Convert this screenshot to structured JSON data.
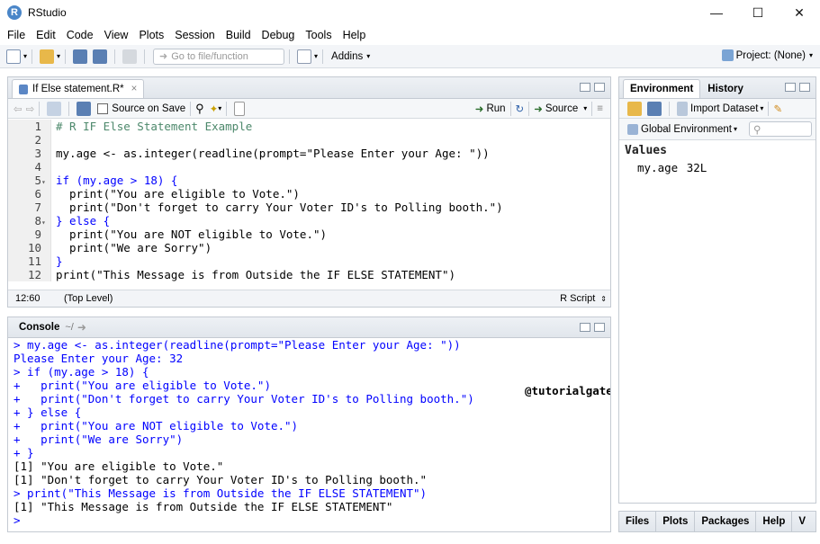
{
  "window": {
    "title": "RStudio",
    "logo": "R"
  },
  "menu": [
    "File",
    "Edit",
    "Code",
    "View",
    "Plots",
    "Session",
    "Build",
    "Debug",
    "Tools",
    "Help"
  ],
  "toolbar": {
    "goto_placeholder": "Go to file/function",
    "addins": "Addins",
    "project": "Project: (None)"
  },
  "editor": {
    "tab": "If Else statement.R*",
    "source_on_save": "Source on Save",
    "run": "Run",
    "source": "Source",
    "lines": [
      "# R IF Else Statement Example",
      "",
      "my.age <- as.integer(readline(prompt=\"Please Enter your Age: \"))",
      "",
      "if (my.age > 18) {",
      "  print(\"You are eligible to Vote.\")",
      "  print(\"Don't forget to carry Your Voter ID's to Polling booth.\")",
      "} else {",
      "  print(\"You are NOT eligible to Vote.\")",
      "  print(\"We are Sorry\")",
      "}",
      "print(\"This Message is from Outside the IF ELSE STATEMENT\")",
      ""
    ],
    "cursor": "12:60",
    "scope": "(Top Level)",
    "filetype": "R Script"
  },
  "console": {
    "title": "Console",
    "path": "~/",
    "watermark": "@tutorialgateway.org",
    "lines": [
      {
        "t": "in",
        "s": "> my.age <- as.integer(readline(prompt=\"Please Enter your Age: \"))"
      },
      {
        "t": "in",
        "s": "Please Enter your Age: 32"
      },
      {
        "t": "in",
        "s": "> if (my.age > 18) {"
      },
      {
        "t": "in",
        "s": "+   print(\"You are eligible to Vote.\")"
      },
      {
        "t": "in",
        "s": "+   print(\"Don't forget to carry Your Voter ID's to Polling booth.\")"
      },
      {
        "t": "in",
        "s": "+ } else {"
      },
      {
        "t": "in",
        "s": "+   print(\"You are NOT eligible to Vote.\")"
      },
      {
        "t": "in",
        "s": "+   print(\"We are Sorry\")"
      },
      {
        "t": "in",
        "s": "+ }"
      },
      {
        "t": "out",
        "s": "[1] \"You are eligible to Vote.\""
      },
      {
        "t": "out",
        "s": "[1] \"Don't forget to carry Your Voter ID's to Polling booth.\""
      },
      {
        "t": "in",
        "s": "> print(\"This Message is from Outside the IF ELSE STATEMENT\")"
      },
      {
        "t": "out",
        "s": "[1] \"This Message is from Outside the IF ELSE STATEMENT\""
      },
      {
        "t": "in",
        "s": "> "
      }
    ]
  },
  "environment": {
    "tabs": [
      "Environment",
      "History"
    ],
    "import_dataset": "Import Dataset",
    "scope": "Global Environment",
    "section": "Values",
    "var_name": "my.age",
    "var_value": "32L"
  },
  "files_tabs": [
    "Files",
    "Plots",
    "Packages",
    "Help",
    "V"
  ],
  "colors": {
    "keyword": "#0000ff",
    "comment": "#4c886b",
    "string": "#036a07",
    "console_input": "#0000ff"
  }
}
